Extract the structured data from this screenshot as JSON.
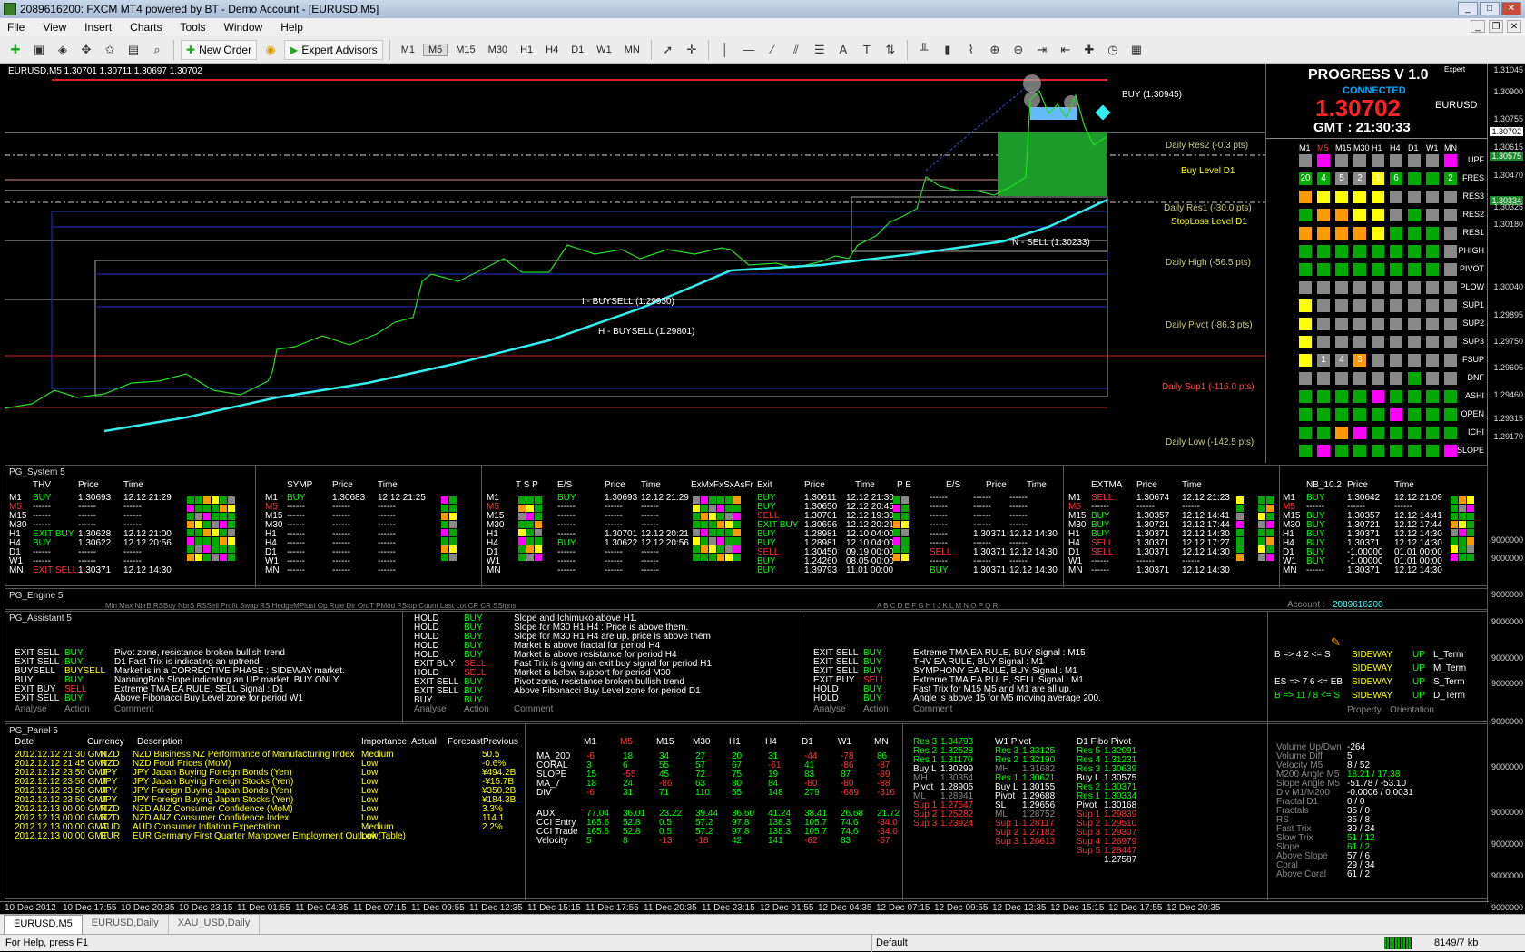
{
  "window": {
    "title": "2089616200: FXCM MT4 powered by BT - Demo Account - [EURUSD,M5]"
  },
  "menu": [
    "File",
    "View",
    "Insert",
    "Charts",
    "Tools",
    "Window",
    "Help"
  ],
  "toolbar": {
    "new_order": "New Order",
    "expert_advisors": "Expert Advisors",
    "timeframes": [
      "M1",
      "M5",
      "M15",
      "M30",
      "H1",
      "H4",
      "D1",
      "W1",
      "MN"
    ]
  },
  "chart": {
    "header": "EURUSD,M5  1.30701 1.30711 1.30697 1.30702",
    "levels": [
      {
        "text": "BUY (1.30945)",
        "color": "#fff"
      },
      {
        "text": "Daily Res2 (-0.3 pts)",
        "color": "#cc8"
      },
      {
        "text": "Buy Level D1",
        "color": "#ff0"
      },
      {
        "text": "Daily Res1 (-30.0 pts)",
        "color": "#cc8"
      },
      {
        "text": "StopLoss Level D1",
        "color": "#ff0"
      },
      {
        "text": "N - SELL (1.30233)",
        "color": "#fff"
      },
      {
        "text": "Daily High (-56.5 pts)",
        "color": "#cc8"
      },
      {
        "text": "I - BUYSELL (1.29950)",
        "color": "#fff"
      },
      {
        "text": "H - BUYSELL (1.29801)",
        "color": "#fff"
      },
      {
        "text": "Daily Pivot (-86.3 pts)",
        "color": "#cc8"
      },
      {
        "text": "Daily Sup1 (-116.0 pts)",
        "color": "#f44"
      },
      {
        "text": "Daily Low (-142.5 pts)",
        "color": "#cc8"
      }
    ]
  },
  "prices": [
    "1.31045",
    "1.30900",
    "1.30755",
    "1.30702",
    "1.30615",
    "1.30575",
    "1.30470",
    "1.30334",
    "1.30325",
    "1.30180",
    "1.30040",
    "1.29895",
    "1.29750",
    "1.29605",
    "1.29460",
    "1.29315",
    "1.29170",
    "9000000",
    "9000000",
    "9000000",
    "9000000",
    "9000000",
    "9000000",
    "9000000",
    "9000000",
    "9000000",
    "9000000",
    "9000000",
    "9000000"
  ],
  "progress": {
    "title": "PROGRESS  V 1.0",
    "expert": "Expert",
    "connected": "CONNECTED",
    "price": "1.30702",
    "symbol": "EURUSD",
    "gmt": "GMT : 21:30:33",
    "tfs": [
      "M1",
      "M5",
      "M15",
      "M30",
      "H1",
      "H4",
      "D1",
      "W1",
      "MN"
    ],
    "rows": [
      "UPF",
      "FRES",
      "RES3",
      "RES2",
      "RES1",
      "PHIGH",
      "PIVOT",
      "PLOW",
      "SUP1",
      "SUP2",
      "SUP3",
      "FSUP",
      "DNF",
      "ASHI",
      "OPEN",
      "ICHI",
      "SLOPE"
    ],
    "fres_nums": [
      "20",
      "4",
      "5",
      "2",
      "1",
      "6",
      "",
      "",
      "2"
    ],
    "fsup_nums": [
      "",
      "1",
      "4",
      "3",
      "",
      "",
      "",
      "",
      ""
    ]
  },
  "system": {
    "title": "PG_System 5",
    "thv": {
      "hdr": [
        "THV",
        "Price",
        "Time"
      ],
      "tfs": [
        "M1",
        "M5",
        "M15",
        "M30",
        "H1",
        "H4",
        "D1",
        "W1",
        "MN"
      ],
      "rows": [
        [
          "BUY",
          "1.30693",
          "12.12 21:29"
        ],
        [
          "------",
          "------",
          "------"
        ],
        [
          "------",
          "------",
          "------"
        ],
        [
          "------",
          "------",
          "------"
        ],
        [
          "EXIT BUY",
          "1.30628",
          "12.12 21:00"
        ],
        [
          "BUY",
          "1.30622",
          "12.12 20:56"
        ],
        [
          "------",
          "------",
          "------"
        ],
        [
          "------",
          "------",
          "------"
        ],
        [
          "EXIT SELL",
          "1.30371",
          "12.12 14:30"
        ]
      ]
    },
    "symp": {
      "hdr": [
        "SYMP",
        "Price",
        "Time"
      ],
      "rows": [
        [
          "BUY",
          "1.30683",
          "12.12 21:25"
        ],
        [
          "------",
          "------",
          "------"
        ],
        [
          "------",
          "------",
          "------"
        ],
        [
          "------",
          "------",
          "------"
        ],
        [
          "------",
          "------",
          "------"
        ],
        [
          "------",
          "------",
          "------"
        ],
        [
          "------",
          "------",
          "------"
        ],
        [
          "------",
          "------",
          "------"
        ],
        [
          "------",
          "------",
          "------"
        ]
      ]
    },
    "tsp": {
      "hdr": [
        "T  S  P",
        "E/S",
        "Price",
        "Time",
        "ExMxFxSxAsFr",
        "Exit",
        "Price",
        "Time",
        "P  E",
        "E/S",
        "Price",
        "Time"
      ],
      "rows": [
        [
          "BUY",
          "1.30693",
          "12.12 21:29",
          "BUY",
          "1.30611",
          "12.12 21:30",
          "------",
          "------",
          "------"
        ],
        [
          "------",
          "------",
          "------",
          "BUY",
          "1.30650",
          "12.12 20:45",
          "------",
          "------",
          "------"
        ],
        [
          "------",
          "------",
          "------",
          "SELL",
          "1.30701",
          "12.12 19:30",
          "------",
          "------",
          "------"
        ],
        [
          "------",
          "------",
          "------",
          "EXIT BUY",
          "1.30696",
          "12.12 20:21",
          "------",
          "------",
          "------"
        ],
        [
          "------",
          "1.30701",
          "12.12 20:21",
          "BUY",
          "1.28981",
          "12.10 04:00",
          "------",
          "1.30371",
          "12.12 14:30"
        ],
        [
          "BUY",
          "1.30622",
          "12.12 20:56",
          "BUY",
          "1.28981",
          "12.10 04:00",
          "------",
          "------",
          "------"
        ],
        [
          "------",
          "------",
          "------",
          "SELL",
          "1.30450",
          "09.19 00:00",
          "SELL",
          "1.30371",
          "12.12 14:30"
        ],
        [
          "------",
          "------",
          "------",
          "BUY",
          "1.24260",
          "08.05 00:00",
          "------",
          "------",
          "------"
        ],
        [
          "------",
          "------",
          "------",
          "BUY",
          "1.39793",
          "11.01 00:00",
          "BUY",
          "1.30371",
          "12.12 14:30"
        ]
      ]
    },
    "extma": {
      "hdr": [
        "EXTMA",
        "Price",
        "Time"
      ],
      "rows": [
        [
          "SELL",
          "1.30674",
          "12.12 21:23"
        ],
        [
          "------",
          "------",
          "------"
        ],
        [
          "BUY",
          "1.30357",
          "12.12 14:41"
        ],
        [
          "BUY",
          "1.30721",
          "12.12 17:44"
        ],
        [
          "BUY",
          "1.30371",
          "12.12 14:30"
        ],
        [
          "SELL",
          "1.30371",
          "12.12 17:27"
        ],
        [
          "SELL",
          "1.30371",
          "12.12 14:30"
        ],
        [
          "------",
          "------",
          "------"
        ],
        [
          "------",
          "1.30371",
          "12.12 14:30"
        ]
      ]
    },
    "nb": {
      "hdr": [
        "NB_10.2",
        "Price",
        "Time"
      ],
      "rows": [
        [
          "BUY",
          "1.30642",
          "12.12 21:09"
        ],
        [
          "------",
          "------",
          "------"
        ],
        [
          "BUY",
          "1.30357",
          "12.12 14:41"
        ],
        [
          "BUY",
          "1.30721",
          "12.12 17:44"
        ],
        [
          "BUY",
          "1.30371",
          "12.12 14:30"
        ],
        [
          "BUY",
          "1.30371",
          "12.12 14:30"
        ],
        [
          "BUY",
          "-1.00000",
          "01.01 00:00"
        ],
        [
          "BUY",
          "-1.00000",
          "01.01 00:00"
        ],
        [
          "------",
          "1.30371",
          "12.12 14:30"
        ]
      ]
    }
  },
  "engine": {
    "title": "PG_Engine 5",
    "account_label": "Account :",
    "account": "2089616200",
    "hdr_left": "Min  Max  NbrB  RSBuy  NbrS  RSSell  Profit  Swap  RS  HedgeMPlust  Op  Rule  Dir  OrdT  PMod  PStop  Count  Last  Lot  CR CR SSigns",
    "hdr_right": "A B C D E F G H I  J  K  L  M  N  O  P  Q  R"
  },
  "assistant": {
    "title": "PG_Assistant 5",
    "left": [
      [
        "EXIT SELL",
        "BUY",
        "Pivot zone, resistance broken bullish trend"
      ],
      [
        "EXIT SELL",
        "BUY",
        "D1 Fast Trix is indicating an uptrend"
      ],
      [
        "BUYSELL",
        "BUYSELL",
        "Market is in a CORRECTIVE PHASE : SIDEWAY market."
      ],
      [
        "BUY",
        "BUY",
        "NanningBob Slope indicating an UP market. BUY ONLY"
      ],
      [
        "EXIT BUY",
        "SELL",
        "Extreme TMA EA RULE, SELL Signal : D1"
      ],
      [
        "EXIT SELL",
        "BUY",
        "Above Fibonacci Buy Level zone for period W1"
      ]
    ],
    "footer": [
      "Analyse",
      "Action",
      "Comment"
    ],
    "mid": [
      [
        "HOLD",
        "BUY",
        "Slope and Ichimuko above H1."
      ],
      [
        "HOLD",
        "BUY",
        "Slope for M30 H1 H4 : Price is above them."
      ],
      [
        "HOLD",
        "BUY",
        "Slope for M30 H1 H4 are up, price is above them"
      ],
      [
        "HOLD",
        "BUY",
        "Market is above fractal for period H4"
      ],
      [
        "HOLD",
        "BUY",
        "Market is above resistance for period H4"
      ],
      [
        "EXIT BUY",
        "SELL",
        "Fast Trix is giving an exit buy signal for period H1"
      ],
      [
        "HOLD",
        "SELL",
        "Market is below support for period M30"
      ],
      [
        "EXIT SELL",
        "BUY",
        "Pivot zone, resistance broken bullish trend"
      ],
      [
        "EXIT SELL",
        "BUY",
        "Above Fibonacci Buy Level zone for period D1"
      ],
      [
        "BUY",
        "BUY",
        ""
      ]
    ],
    "right": [
      [
        "EXIT SELL",
        "BUY",
        "Extreme TMA EA RULE, BUY Signal : M15"
      ],
      [
        "EXIT SELL",
        "BUY",
        "THV EA RULE, BUY Signal : M1"
      ],
      [
        "EXIT SELL",
        "BUY",
        "SYMPHONY EA RULE, BUY Signal : M1"
      ],
      [
        "EXIT BUY",
        "SELL",
        "Extreme TMA EA RULE, SELL Signal : M1"
      ],
      [
        "HOLD",
        "BUY",
        "Fast Trix for M15 M5 and M1 are all up."
      ],
      [
        "HOLD",
        "BUY",
        "Angle is above 15 for M5 moving average 200."
      ]
    ],
    "orient": [
      [
        "B => 4   2 <= S",
        "SIDEWAY",
        "UP",
        "L_Term"
      ],
      [
        "",
        "SIDEWAY",
        "UP",
        "M_Term"
      ],
      [
        "ES => 7   6 <= EB",
        "SIDEWAY",
        "UP",
        "S_Term"
      ],
      [
        "B => 11 / 8 <= S",
        "SIDEWAY",
        "UP",
        "D_Term"
      ]
    ],
    "orient_footer": [
      "Property",
      "Orientation"
    ]
  },
  "panel": {
    "title": "PG_Panel 5",
    "news_hdr": [
      "Date",
      "Currency",
      "Description",
      "Importance",
      "Actual",
      "Forecast",
      "Previous"
    ],
    "news": [
      [
        "2012.12.12 21:30 GMT",
        "NZD",
        "NZD Business NZ Performance of Manufacturing Index",
        "Medium",
        "",
        "50.5"
      ],
      [
        "2012.12.12 21:45 GMT",
        "NZD",
        "NZD Food Prices (MoM)",
        "Low",
        "",
        "-0.6%"
      ],
      [
        "2012.12.12 23:50 GMT",
        "JPY",
        "JPY Japan Buying Foreign Bonds (Yen)",
        "Low",
        "",
        "¥494.2B"
      ],
      [
        "2012.12.12 23:50 GMT",
        "JPY",
        "JPY Japan Buying Foreign Stocks (Yen)",
        "Low",
        "",
        "-¥15.7B"
      ],
      [
        "2012.12.12 23:50 GMT",
        "JPY",
        "JPY Foreign Buying Japan Bonds (Yen)",
        "Low",
        "",
        "¥350.2B"
      ],
      [
        "2012.12.12 23:50 GMT",
        "JPY",
        "JPY Foreign Buying Japan Stocks (Yen)",
        "Low",
        "",
        "¥184.3B"
      ],
      [
        "2012.12.13 00:00 GMT",
        "NZD",
        "NZD ANZ Consumer Confidence (MoM)",
        "Low",
        "",
        "3.3%"
      ],
      [
        "2012.12.13 00:00 GMT",
        "NZD",
        "NZD ANZ Consumer Confidence Index",
        "Low",
        "",
        "114.1"
      ],
      [
        "2012.12.13 00:00 GMT",
        "AUD",
        "AUD Consumer Inflation Expectation",
        "Medium",
        "",
        "2.2%"
      ],
      [
        "2012.12.13 00:00 GMT",
        "EUR",
        "EUR Germany First Quarter Manpower Employment Outlook",
        "Low(Table)",
        "",
        " "
      ]
    ],
    "ind_tfs": [
      "M1",
      "M5",
      "M15",
      "M30",
      "H1",
      "H4",
      "D1",
      "W1",
      "MN"
    ],
    "ind": [
      [
        "MA_200",
        "-6",
        "18",
        "34",
        "27",
        "20",
        "31",
        "-44",
        "-78",
        "86"
      ],
      [
        "CORAL",
        "3",
        "6",
        "55",
        "57",
        "67",
        "-61",
        "41",
        "-86",
        "-87"
      ],
      [
        "SLOPE",
        "15",
        "-55",
        "45",
        "72",
        "75",
        "19",
        "83",
        "87",
        "-89"
      ],
      [
        "MA_7",
        "18",
        "24",
        "-86",
        "63",
        "80",
        "84",
        "-80",
        "-80",
        "-88"
      ],
      [
        "DIV",
        "-6",
        "31",
        "71",
        "110",
        "55",
        "148",
        "279",
        "-689",
        "-316"
      ]
    ],
    "adx": [
      "ADX",
      "77.04",
      "36.01",
      "23.22",
      "39.44",
      "36.60",
      "41.24",
      "38.41",
      "26.68",
      "21.72"
    ],
    "cci": [
      [
        "CCI Entry",
        "165.6",
        "52.8",
        "0.5",
        "57.2",
        "97.8",
        "138.3",
        "105.7",
        "74.6",
        "-34.0"
      ],
      [
        "CCI Trade",
        "165.6",
        "52.8",
        "0.5",
        "57.2",
        "97.8",
        "138.3",
        "105.7",
        "74.6",
        "-34.0"
      ],
      [
        "Velocity",
        "5",
        "8",
        "-13",
        "-18",
        "42",
        "141",
        "-62",
        "83",
        "-57"
      ]
    ],
    "pivots": {
      "left": [
        [
          "Res 3",
          "1.34793"
        ],
        [
          "Res 2",
          "1.32528"
        ],
        [
          "Res 1",
          "1.31170"
        ],
        [
          "Buy L",
          "1.30299"
        ],
        [
          "MH",
          "1.30354"
        ],
        [
          "Pivot",
          "1.28905"
        ],
        [
          "ML",
          "1.28941"
        ],
        [
          "Sup 1",
          "1.27547"
        ],
        [
          "Sup 2",
          "1.25282"
        ],
        [
          "Sup 3",
          "1.23924"
        ]
      ],
      "mid": [
        [
          "W1 Pivot",
          ""
        ],
        [
          "Res 3",
          "1.33125"
        ],
        [
          "Res 2",
          "1.32190"
        ],
        [
          "MH",
          "1.31682"
        ],
        [
          "Res 1",
          "1.30621"
        ],
        [
          "Buy L",
          "1.30155"
        ],
        [
          "Pivot",
          "1.29688"
        ],
        [
          "SL",
          "1.29656"
        ],
        [
          "ML",
          "1.28752"
        ],
        [
          "Sup 1",
          "1.28117"
        ],
        [
          "Sup 2",
          "1.27182"
        ],
        [
          "Sup 3",
          "1.26613"
        ]
      ],
      "right": [
        [
          "D1 Fibo Pivot",
          ""
        ],
        [
          "Res 5",
          "1.32091"
        ],
        [
          "Res 4",
          "1.31231"
        ],
        [
          "Res 3",
          "1.30639"
        ],
        [
          "Buy L",
          "1.30575"
        ],
        [
          "Res 2",
          "1.30371"
        ],
        [
          "Res 1",
          "1.30334"
        ],
        [
          "Pivot",
          "1.30168"
        ],
        [
          "Sup 1",
          "1.29839"
        ],
        [
          "Sup 2",
          "1.29510"
        ],
        [
          "Sup 3",
          "1.29307"
        ],
        [
          "Sup 4",
          "1.26979"
        ],
        [
          "Sup 5",
          "1.28447"
        ],
        [
          "",
          "1.27587"
        ]
      ]
    },
    "stats": [
      [
        "Volume Up/Dwn",
        "-264"
      ],
      [
        "Volume Diff",
        "5"
      ],
      [
        "Velocity M5",
        "8 / 52"
      ],
      [
        "M200 Angle M5",
        "18.21 / 17.38"
      ],
      [
        "Slope Angle M5",
        "-51.78 / -53.10"
      ],
      [
        "Div M1/M200",
        "-0.0006 / 0.0031"
      ],
      [
        "Fractal D1",
        "0 / 0"
      ],
      [
        "Fractals",
        "35 / 0"
      ],
      [
        "RS",
        "35 / 8"
      ],
      [
        "Fast Trix",
        "39 / 24"
      ],
      [
        "Slow Trix",
        "51 / 12"
      ],
      [
        "Slope",
        "61 / 2"
      ],
      [
        "Above Slope",
        "57 / 6"
      ],
      [
        "Coral",
        "29 / 34"
      ],
      [
        "Above Coral",
        "61 / 2"
      ]
    ]
  },
  "time_labels": [
    "10 Dec 2012",
    "10 Dec 17:55",
    "10 Dec 20:35",
    "10 Dec 23:15",
    "11 Dec 01:55",
    "11 Dec 04:35",
    "11 Dec 07:15",
    "11 Dec 09:55",
    "11 Dec 12:35",
    "11 Dec 15:15",
    "11 Dec 17:55",
    "11 Dec 20:35",
    "11 Dec 23:15",
    "12 Dec 01:55",
    "12 Dec 04:35",
    "12 Dec 07:15",
    "12 Dec 09:55",
    "12 Dec 12:35",
    "12 Dec 15:15",
    "12 Dec 17:55",
    "12 Dec 20:35"
  ],
  "tabs": [
    "EURUSD,M5",
    "EURUSD,Daily",
    "XAU_USD,Daily"
  ],
  "status": {
    "help": "For Help, press F1",
    "profile": "Default",
    "traffic": "8149/7 kb"
  }
}
